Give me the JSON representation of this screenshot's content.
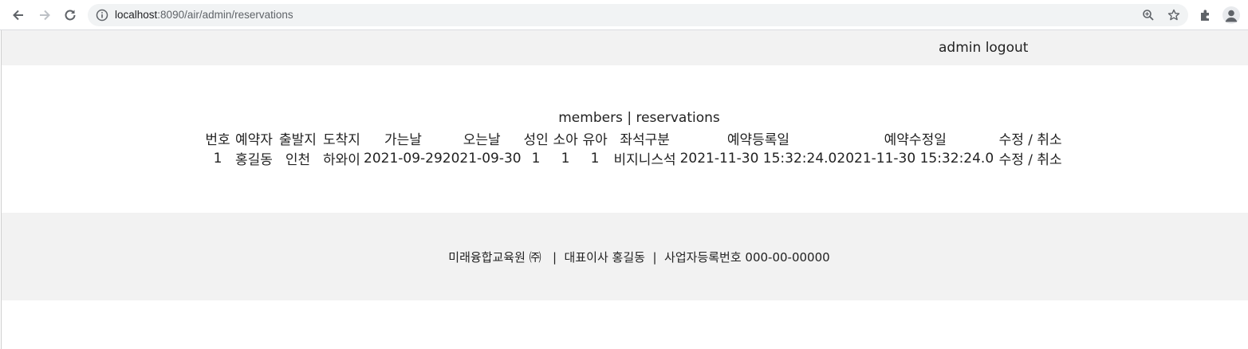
{
  "browser": {
    "url_host": "localhost",
    "url_path": ":8090/air/admin/reservations",
    "icons": [
      "back-icon",
      "forward-icon",
      "reload-icon",
      "site-info-icon",
      "zoom-icon",
      "bookmark-star-icon",
      "extensions-icon",
      "profile-icon"
    ]
  },
  "header": {
    "admin_label": "admin",
    "logout_label": "logout"
  },
  "menu": {
    "members_label": "members",
    "separator": "|",
    "reservations_label": "reservations"
  },
  "table": {
    "columns": [
      "번호",
      "예약자",
      "출발지",
      "도착지",
      "가는날",
      "오는날",
      "성인",
      "소아",
      "유아",
      "좌석구분",
      "예약등록일",
      "예약수정일",
      "수정 / 취소"
    ],
    "rows": [
      {
        "no": "1",
        "name": "홍길동",
        "departure": "인천",
        "arrival": "하와이",
        "go_date": "2021-09-29",
        "return_date": "2021-09-30",
        "adult": "1",
        "child": "1",
        "infant": "1",
        "seat_class": "비지니스석",
        "reg_date": "2021-11-30 15:32:24.0",
        "mod_date": "2021-11-30 15:32:24.0",
        "edit_label": "수정",
        "action_separator": " / ",
        "cancel_label": "취소"
      }
    ]
  },
  "footer": {
    "text": "미래융합교육원 ㈜   |  대표이사 홍길동  |  사업자등록번호 000-00-00000"
  }
}
